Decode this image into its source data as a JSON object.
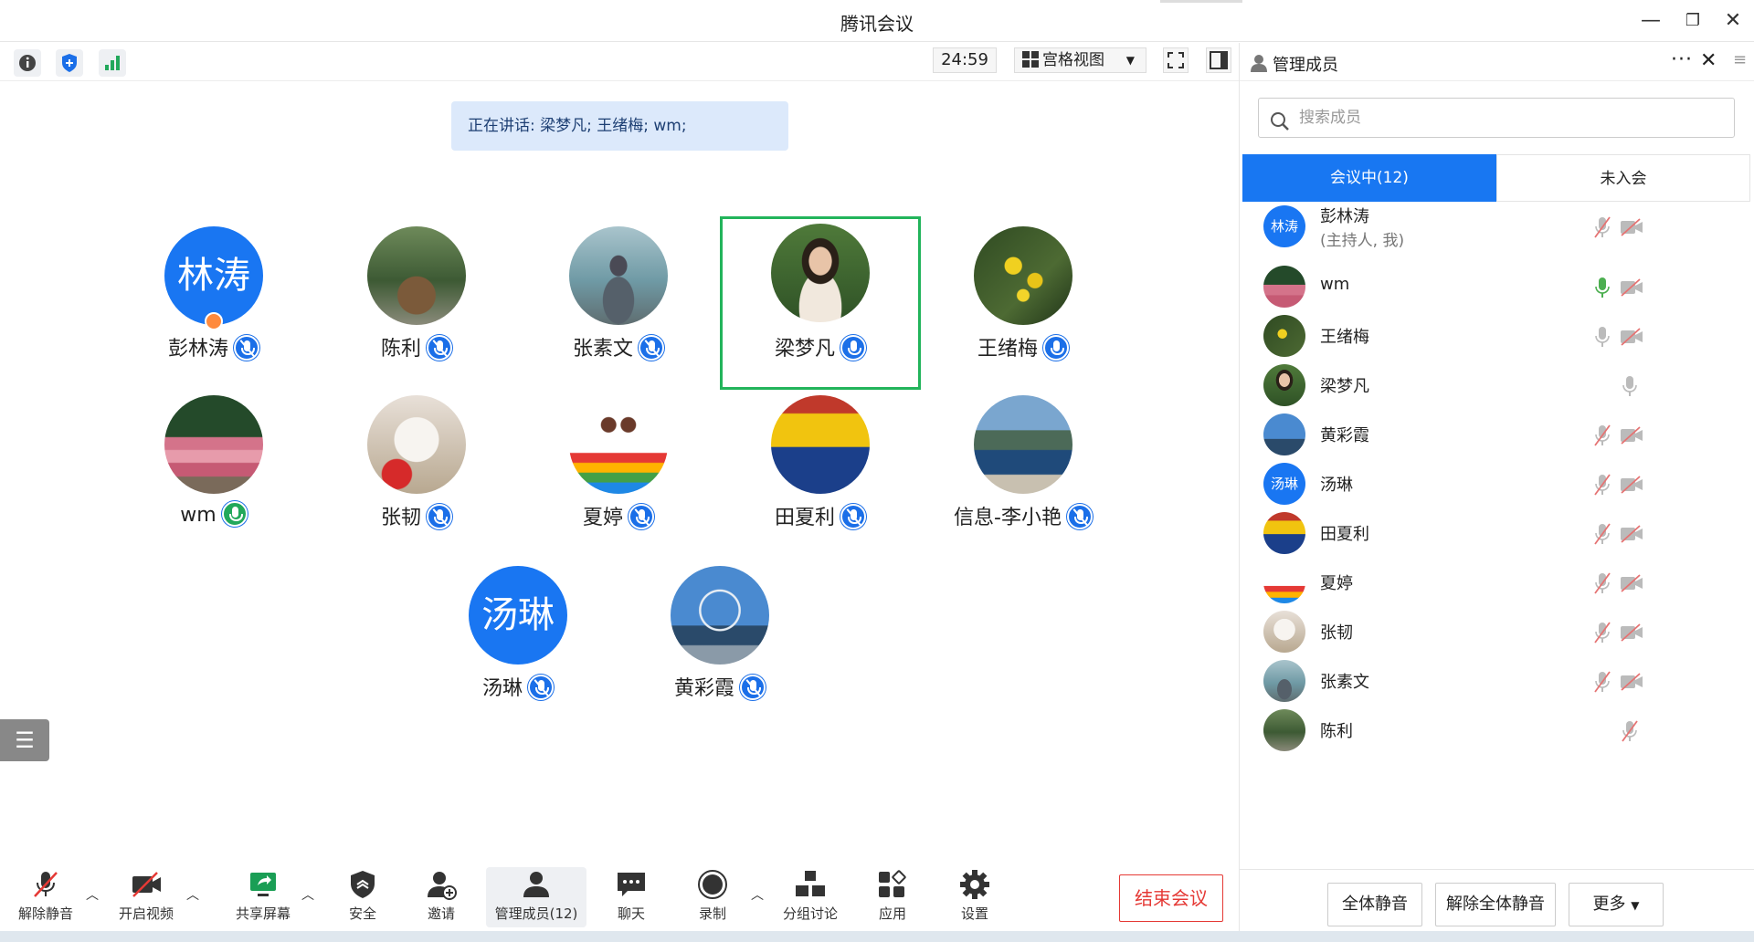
{
  "window": {
    "title": "腾讯会议"
  },
  "toolbar": {
    "timer": "24:59",
    "view_label": "宫格视图"
  },
  "speaking": "正在讲话: 梁梦凡; 王绪梅; wm;",
  "tiles": [
    {
      "name": "彭林涛",
      "avatar_text": "林涛"
    },
    {
      "name": "陈利"
    },
    {
      "name": "张素文"
    },
    {
      "name": "梁梦凡"
    },
    {
      "name": "王绪梅"
    },
    {
      "name": "wm"
    },
    {
      "name": "张韧"
    },
    {
      "name": "夏婷"
    },
    {
      "name": "田夏利"
    },
    {
      "name": "信息-李小艳"
    },
    {
      "name": "汤琳",
      "avatar_text": "汤琳"
    },
    {
      "name": "黄彩霞"
    }
  ],
  "bottom": {
    "unmute": "解除静音",
    "video": "开启视频",
    "share": "共享屏幕",
    "security": "安全",
    "invite": "邀请",
    "members": "管理成员(12)",
    "chat": "聊天",
    "record": "录制",
    "breakout": "分组讨论",
    "apps": "应用",
    "settings": "设置",
    "end": "结束会议"
  },
  "sidebar": {
    "title": "管理成员",
    "search_placeholder": "搜索成员",
    "tab_in": "会议中(12)",
    "tab_out": "未入会",
    "members": [
      {
        "name": "彭林涛",
        "sub": "(主持人, 我)",
        "avatar_text": "林涛"
      },
      {
        "name": "wm"
      },
      {
        "name": "王绪梅"
      },
      {
        "name": "梁梦凡"
      },
      {
        "name": "黄彩霞"
      },
      {
        "name": "汤琳",
        "avatar_text": "汤琳"
      },
      {
        "name": "田夏利"
      },
      {
        "name": "夏婷"
      },
      {
        "name": "张韧"
      },
      {
        "name": "张素文"
      },
      {
        "name": "陈利"
      }
    ],
    "mute_all": "全体静音",
    "unmute_all": "解除全体静音",
    "more": "更多"
  },
  "colors": {
    "accent": "#1877f2",
    "active_border": "#22b45b",
    "end": "#e53935"
  }
}
